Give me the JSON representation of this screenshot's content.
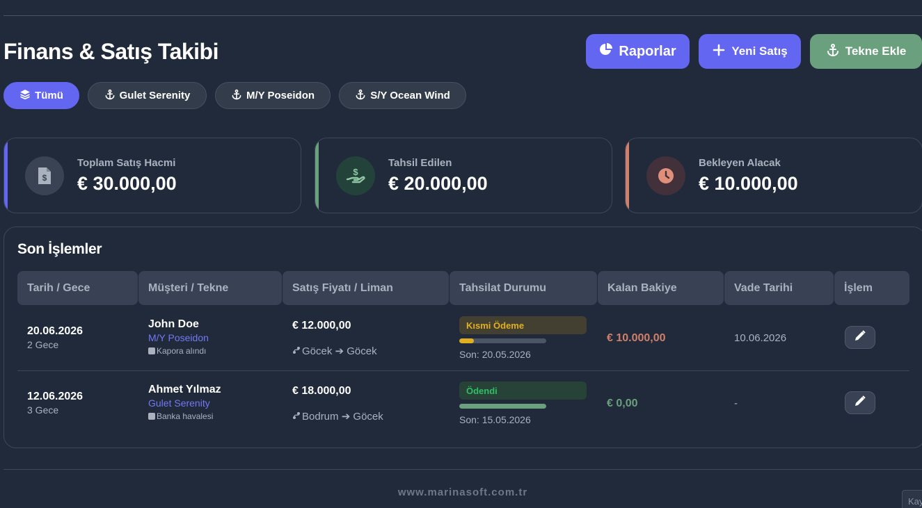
{
  "header": {
    "title": "Finans & Satış Takibi",
    "actions": [
      {
        "label": "Raporlar",
        "icon": "pie-chart-icon",
        "color": "#6366f1"
      },
      {
        "label": "Yeni Satış",
        "icon": "plus-icon",
        "color": "#6366f1"
      },
      {
        "label": "Tekne Ekle",
        "icon": "anchor-icon",
        "color": "#6aa07e"
      }
    ]
  },
  "filters": [
    {
      "label": "Tümü",
      "icon": "layers-icon",
      "active": true
    },
    {
      "label": "Gulet Serenity",
      "icon": "anchor-icon",
      "active": false
    },
    {
      "label": "M/Y Poseidon",
      "icon": "anchor-icon",
      "active": false
    },
    {
      "label": "S/Y Ocean Wind",
      "icon": "anchor-icon",
      "active": false
    }
  ],
  "stats": [
    {
      "label": "Toplam Satış Hacmi",
      "value": "€ 30.000,00",
      "icon": "invoice-dollar-icon",
      "accent": "#6366f1"
    },
    {
      "label": "Tahsil Edilen",
      "value": "€ 20.000,00",
      "icon": "hand-dollar-icon",
      "accent": "#6aa07e"
    },
    {
      "label": "Bekleyen Alacak",
      "value": "€ 10.000,00",
      "icon": "clock-icon",
      "accent": "#d0806a"
    }
  ],
  "transactions": {
    "title": "Son İşlemler",
    "columns": [
      "Tarih / Gece",
      "Müşteri / Tekne",
      "Satış Fiyatı / Liman",
      "Tahsilat Durumu",
      "Kalan Bakiye",
      "Vade Tarihi",
      "İşlem"
    ],
    "rows": [
      {
        "date": "20.06.2026",
        "nights": "2 Gece",
        "customer": "John Doe",
        "boat": "M/Y Poseidon",
        "note": "Kapora alındı",
        "price": "€ 12.000,00",
        "route": "Göcek ➔ Göcek",
        "status": "Kısmi Ödeme",
        "paid_fraction": 0.17,
        "last_payment": "Son: 20.05.2026",
        "balance": "€ 10.000,00",
        "due": "10.06.2026"
      },
      {
        "date": "12.06.2026",
        "nights": "3 Gece",
        "customer": "Ahmet Yılmaz",
        "boat": "Gulet Serenity",
        "note": "Banka havalesi",
        "price": "€ 18.000,00",
        "route": "Bodrum ➔ Göcek",
        "status": "Ödendi",
        "paid_fraction": 1.0,
        "last_payment": "Son: 15.05.2026",
        "balance": "€ 0,00",
        "due": "-"
      }
    ]
  },
  "footer": {
    "url": "www.marinasoft.com.tr",
    "corner_text": "Kay"
  },
  "colors": {
    "background": "#212a3a",
    "accent": "#6366f1",
    "success": "#6aa07e",
    "warning": "#d0806a",
    "partial_badge_text": "#e0b020",
    "paid_badge_text": "#2fbf66"
  }
}
